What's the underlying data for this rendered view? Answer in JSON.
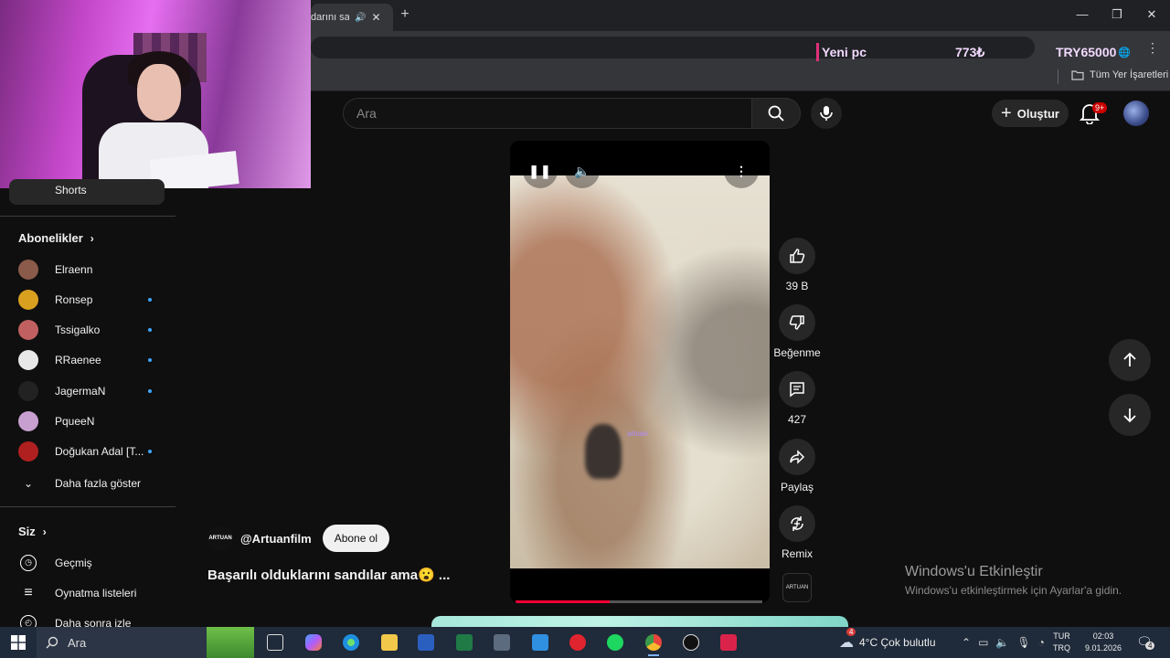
{
  "browser": {
    "tab_title": "darını san",
    "new_tab_label": "+",
    "bookmarks_all": "Tüm Yer İşaretleri",
    "ticker": {
      "label": "Yeni pc",
      "price": "773₺",
      "goal": "TRY65000"
    }
  },
  "header": {
    "search_placeholder": "Ara",
    "create_label": "Oluştur",
    "notification_count": "9+"
  },
  "sidebar": {
    "shorts_label": "Shorts",
    "subscriptions_heading": "Abonelikler",
    "subscriptions": [
      {
        "name": "Elraenn",
        "new": false,
        "color": "#8a5a4a"
      },
      {
        "name": "Ronsep",
        "new": true,
        "color": "#d9a020"
      },
      {
        "name": "Tssigalko",
        "new": true,
        "color": "#c06060"
      },
      {
        "name": "RRaenee",
        "new": true,
        "color": "#e8e8e8"
      },
      {
        "name": "JagermaN",
        "new": true,
        "color": "#222222"
      },
      {
        "name": "PqueeN",
        "new": false,
        "color": "#c8a0d0"
      },
      {
        "name": "Doğukan Adal [T...",
        "new": true,
        "color": "#b02020"
      }
    ],
    "show_more": "Daha fazla göster",
    "you_heading": "Siz",
    "you_items": [
      "Geçmiş",
      "Oynatma listeleri",
      "Daha sonra izle"
    ]
  },
  "short": {
    "watermark": "artuan",
    "progress": 0.38,
    "channel_handle": "@Artuanfilm",
    "channel_avatar_text": "ARTUAN",
    "subscribe_label": "Abone ol",
    "title": "Başarılı olduklarını sandılar ama😮 ...",
    "actions": {
      "like_count": "39 B",
      "dislike_label": "Beğenme",
      "comment_count": "427",
      "share_label": "Paylaş",
      "remix_label": "Remix"
    }
  },
  "activation": {
    "title": "Windows'u Etkinleştir",
    "subtitle": "Windows'u etkinleştirmek için Ayarlar'a gidin."
  },
  "taskbar": {
    "search_label": "Ara",
    "weather": "4°C  Çok bulutlu",
    "weather_badge": "4",
    "lang_top": "TUR",
    "lang_bottom": "TRQ",
    "time": "02:03",
    "date": "9.01.2026",
    "notif_count": "4"
  }
}
